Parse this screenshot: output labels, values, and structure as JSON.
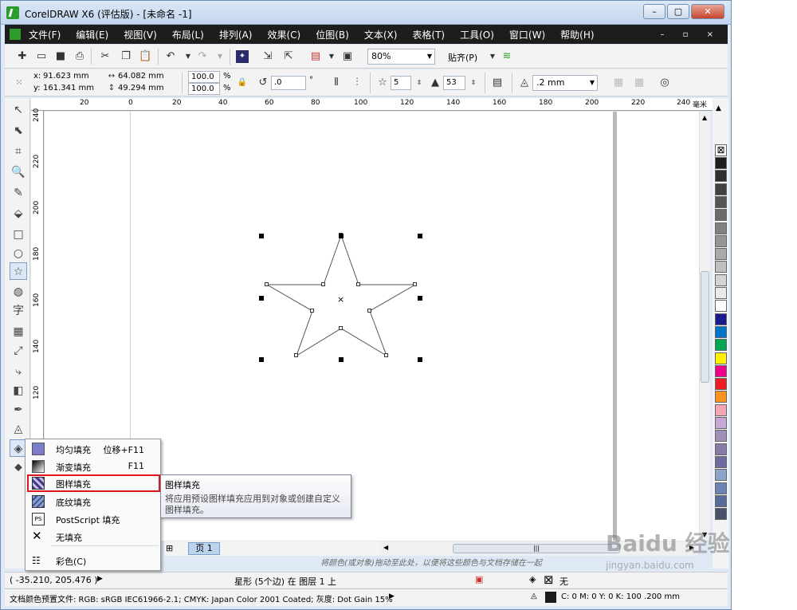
{
  "window": {
    "title": "CorelDRAW X6 (评估版) - [未命名 -1]",
    "buttons": [
      "–",
      "▢",
      "✕"
    ]
  },
  "menubar": {
    "items": [
      "文件(F)",
      "编辑(E)",
      "视图(V)",
      "布局(L)",
      "排列(A)",
      "效果(C)",
      "位图(B)",
      "文本(X)",
      "表格(T)",
      "工具(O)",
      "窗口(W)",
      "帮助(H)"
    ],
    "right_controls": "– ▫ ×"
  },
  "standard_toolbar": {
    "zoom_value": "80%",
    "snap_label": "贴齐(P)"
  },
  "property_bar": {
    "x_label": "x:",
    "x_value": "91.623 mm",
    "y_label": "y:",
    "y_value": "161.341 mm",
    "width_value": "64.082 mm",
    "height_value": "49.294 mm",
    "scale_x": "100.0",
    "scale_y": "100.0",
    "percent": "%",
    "rotation": ".0",
    "degree": "°",
    "points": "5",
    "sharpness": "53",
    "outline_width": ".2 mm"
  },
  "rulers": {
    "horizontal": [
      "20",
      "0",
      "20",
      "40",
      "60",
      "80",
      "100",
      "120",
      "140",
      "160",
      "180",
      "200",
      "220",
      "240"
    ],
    "unit": "毫米",
    "vertical": [
      "240",
      "220",
      "200",
      "180",
      "160",
      "140",
      "120"
    ]
  },
  "flyout": {
    "items": [
      {
        "label": "均匀填充",
        "shortcut": "位移+F11"
      },
      {
        "label": "渐变填充",
        "shortcut": "F11"
      },
      {
        "label": "图样填充",
        "shortcut": ""
      },
      {
        "label": "底纹填充",
        "shortcut": ""
      },
      {
        "label": "PostScript 填充",
        "shortcut": ""
      },
      {
        "label": "无填充",
        "shortcut": ""
      },
      {
        "label": "彩色(C)",
        "shortcut": ""
      }
    ]
  },
  "tooltip": {
    "title": "图样填充",
    "body": "将应用预设图样填充应用到对象或创建自定义图样填充。"
  },
  "pagebar": {
    "page_tab": "页 1"
  },
  "hint_text": "将颜色(或对象)拖动至此处，以便将这些颜色与文档存储在一起",
  "status": {
    "coords": "( -35.210, 205.476 )",
    "object_info": "星形 (5个边) 在 图层 1 上",
    "fill_label": "无",
    "color_profile": "文档颜色预置文件: RGB: sRGB IEC61966-2.1; CMYK: Japan Color 2001 Coated; 灰度: Dot Gain 15%",
    "outline_info": "C: 0 M: 0 Y: 0 K: 100  .200 mm"
  },
  "watermark": {
    "brand": "Baidu 经验",
    "url": "jingyan.baidu.com"
  },
  "palette_colors": [
    "#1c1c1c",
    "#2e2e2e",
    "#404040",
    "#555555",
    "#6a6a6a",
    "#808080",
    "#959595",
    "#aaaaaa",
    "#bfbfbf",
    "#d4d4d4",
    "#eaeaea",
    "#ffffff",
    "#1a1a8c",
    "#0074c8",
    "#00a651",
    "#fff200",
    "#ec008c",
    "#ed1c24",
    "#f7931e",
    "#f4a6b2",
    "#c7a8d4",
    "#a08fb8",
    "#8a7aa8",
    "#6f6aa0",
    "#8ba5c8",
    "#6c84b4",
    "#566b95",
    "#4a4f6e"
  ]
}
